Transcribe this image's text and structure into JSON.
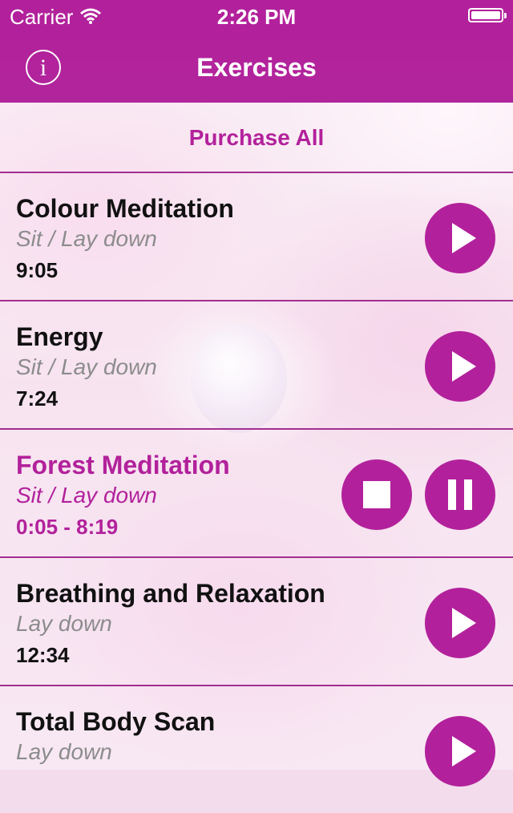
{
  "status": {
    "carrier": "Carrier",
    "time": "2:26 PM"
  },
  "nav": {
    "title": "Exercises",
    "info_icon": "info-icon",
    "info_glyph": "i"
  },
  "purchase_label": "Purchase All",
  "colors": {
    "accent": "#b2219b",
    "text": "#111111",
    "subtext": "#8c8c8c"
  },
  "exercises": [
    {
      "title": "Colour Meditation",
      "position": "Sit / Lay down",
      "duration": "9:05",
      "state": "idle"
    },
    {
      "title": "Energy",
      "position": "Sit / Lay down",
      "duration": "7:24",
      "state": "idle"
    },
    {
      "title": "Forest Meditation",
      "position": "Sit / Lay down",
      "duration": "0:05 - 8:19",
      "state": "playing"
    },
    {
      "title": "Breathing and Relaxation",
      "position": "Lay down",
      "duration": "12:34",
      "state": "idle"
    },
    {
      "title": "Total Body Scan",
      "position": "Lay down",
      "duration": "",
      "state": "idle"
    }
  ]
}
